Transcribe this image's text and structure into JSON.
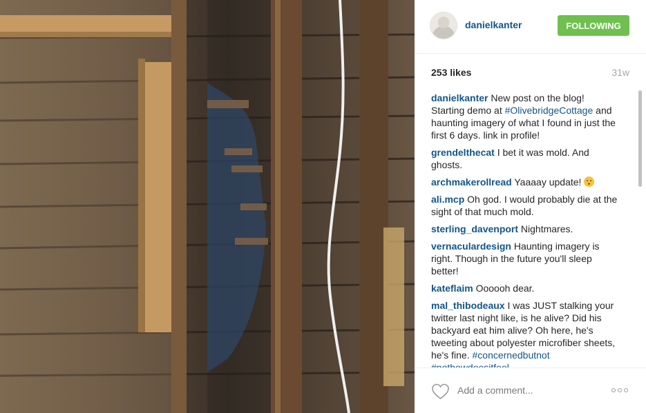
{
  "post": {
    "username": "danielkanter",
    "follow_label": "FOLLOWING",
    "likes": "253 likes",
    "age": "31w"
  },
  "comments": [
    {
      "user": "danielkanter",
      "parts": [
        "New post on the blog! Starting demo at ",
        "#OlivebridgeCottage",
        " and haunting imagery of what I found in just the first 6 days. link in profile!"
      ]
    },
    {
      "user": "grendelthecat",
      "text": "I bet it was mold. And ghosts."
    },
    {
      "user": "archmakerollread",
      "text": "Yaaaay update!"
    },
    {
      "user": "ali.mcp",
      "text": "Oh god. I would probably die at the sight of that much mold."
    },
    {
      "user": "sterling_davenport",
      "text": "Nightmares."
    },
    {
      "user": "vernaculardesign",
      "text": "Haunting imagery is right. Though in the future you'll sleep better!"
    },
    {
      "user": "kateflaim",
      "text": "Oooooh dear."
    },
    {
      "user": "mal_thibodeaux",
      "parts": [
        "I was JUST stalking your twitter last night like, is he alive? Did his backyard eat him alive? Oh here, he's tweeting about polyester microfiber sheets, he's fine. ",
        "#concernedbutnot",
        " ",
        "#nothowdoesitfeel"
      ]
    }
  ],
  "footer": {
    "comment_placeholder": "Add a comment..."
  },
  "icons": {
    "like": "heart-icon",
    "more": "more-options-icon",
    "emoji": "kissing-face-emoji"
  },
  "colors": {
    "accent_link": "#125688",
    "follow_button": "#70c050",
    "muted": "#a5a7aa"
  }
}
